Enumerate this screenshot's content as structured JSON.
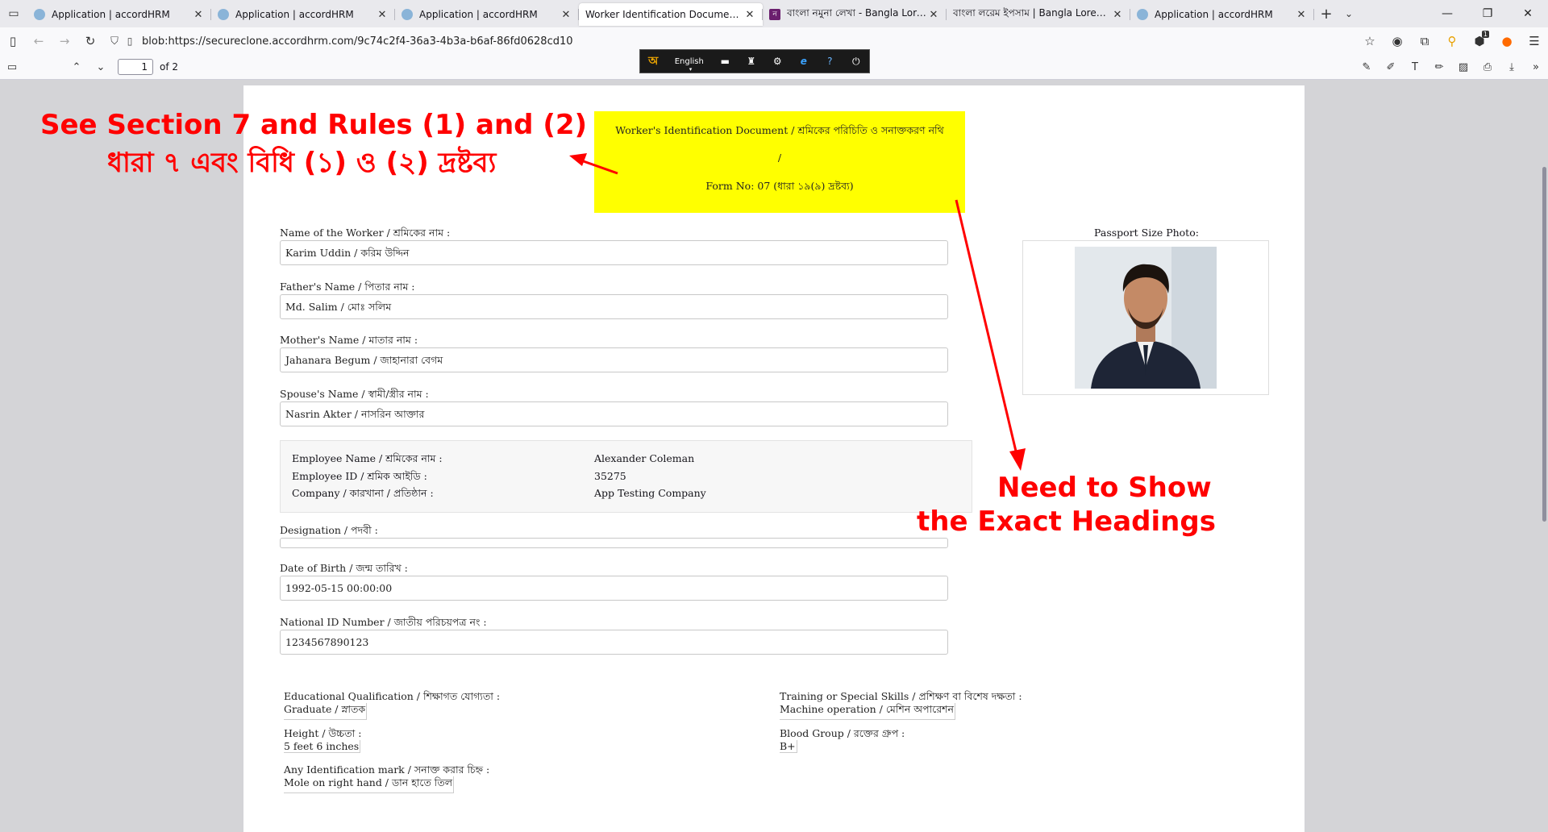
{
  "browser": {
    "tabs": [
      {
        "label": "Application | accordHRM",
        "active": false,
        "favicon": "accordhrm-icon"
      },
      {
        "label": "Application | accordHRM",
        "active": false,
        "favicon": "accordhrm-icon"
      },
      {
        "label": "Application | accordHRM",
        "active": false,
        "favicon": "accordhrm-icon"
      },
      {
        "label": "Worker Identification Document - Emp",
        "active": true,
        "favicon": "none"
      },
      {
        "label": "বাংলা নমুনা লেখা - Bangla Lorem Ip",
        "active": false,
        "favicon": "purple-n-icon"
      },
      {
        "label": "বাংলা লরেম ইপসাম | Bangla Lorem Ip",
        "active": false,
        "favicon": "none"
      },
      {
        "label": "Application | accordHRM",
        "active": false,
        "favicon": "accordhrm-icon"
      }
    ],
    "new_tab": "+",
    "url": "blob:https://secureclone.accordhrm.com/9c74c2f4-36a3-4b3a-b6af-86fd0628cd10",
    "extension_badge": "1"
  },
  "pdf_toolbar": {
    "page_number": "1",
    "page_count": "of 2"
  },
  "lang_toolbar": {
    "language": "English",
    "logo": "অ"
  },
  "document": {
    "header": {
      "line1": "Worker's Identification Document / শ্রমিকের পরিচিতি ও সনাক্তকরণ নথি",
      "line2": "/",
      "line3": "Form No: 07 (ধারা ১৯(৯) দ্রষ্টব্য)"
    },
    "fields": {
      "worker_name_label": "Name of the Worker / শ্রমিকের নাম :",
      "worker_name_value": "Karim Uddin / করিম উদ্দিন",
      "father_label": "Father's Name / পিতার নাম :",
      "father_value": "Md. Salim / মোঃ সলিম",
      "mother_label": "Mother's Name / মাতার নাম :",
      "mother_value": "Jahanara Begum / জাহানারা বেগম",
      "spouse_label": "Spouse's Name / স্বামী/স্ত্রীর নাম :",
      "spouse_value": "Nasrin Akter / নাসরিন আক্তার",
      "designation_label": "Designation / পদবী :",
      "designation_value": "",
      "dob_label": "Date of Birth / জন্ম তারিখ :",
      "dob_value": "1992-05-15 00:00:00",
      "nid_label": "National ID Number / জাতীয় পরিচয়পত্র নং :",
      "nid_value": "1234567890123"
    },
    "photo_label": "Passport Size Photo:",
    "info": {
      "emp_name_label": "Employee Name / শ্রমিকের নাম :",
      "emp_name_value": "Alexander Coleman",
      "emp_id_label": "Employee ID / শ্রমিক আইডি :",
      "emp_id_value": "35275",
      "company_label": "Company / কারখানা / প্রতিষ্ঠান :",
      "company_value": "App Testing Company"
    },
    "qualifications": {
      "edu_label": "Educational Qualification / শিক্ষাগত যোগ্যতা :",
      "edu_value": "Graduate / স্নাতক",
      "training_label": "Training or Special Skills / প্রশিক্ষণ বা বিশেষ দক্ষতা :",
      "training_value": "Machine operation / মেশিন অপারেশন",
      "height_label": "Height / উচ্চতা :",
      "height_value": "5 feet 6 inches",
      "blood_label": "Blood Group / রক্তের গ্রুপ :",
      "blood_value": "B+",
      "mark_label": "Any Identification mark / সনাক্ত করার চিহ্ন :",
      "mark_value": "Mole on right hand / ডান হাতে তিল"
    }
  },
  "annotations": {
    "left_line1": "See Section 7 and Rules (1) and (2)",
    "left_line2": "ধারা ৭ এবং বিধি (১) ও (২) দ্রষ্টব্য",
    "right_line1": "Need to Show",
    "right_line2": "the Exact Headings",
    "color": "#ff0000"
  },
  "colors": {
    "header_highlight": "#ffff00",
    "viewer_bg": "#d4d4d7"
  }
}
